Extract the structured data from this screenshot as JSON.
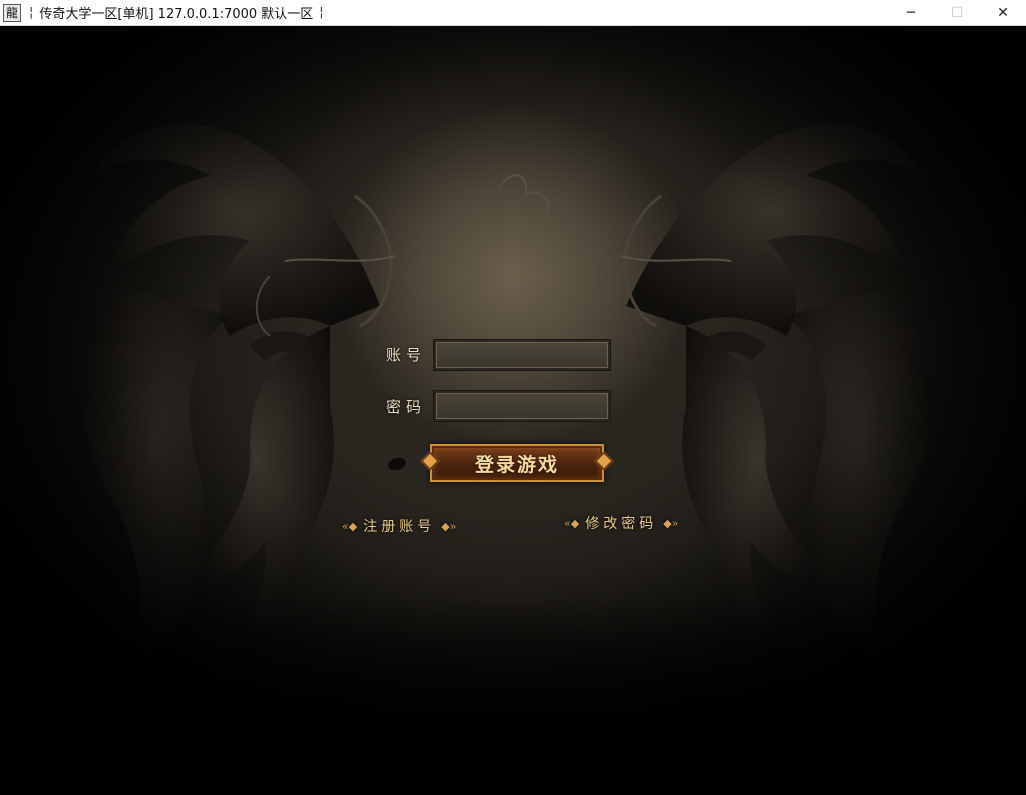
{
  "window": {
    "icon_glyph": "龍",
    "separator": "¦",
    "title": "传奇大学一区[单机] 127.0.0.1:7000  默认一区",
    "minimize": "─",
    "maximize": "☐",
    "close": "✕"
  },
  "login": {
    "account_label": "账号",
    "account_value": "",
    "password_label": "密码",
    "password_value": "",
    "login_button": "登录游戏",
    "register_link": "注册账号",
    "change_password_link": "修改密码",
    "link_arrow_left": "«◆",
    "link_arrow_right": "◆»"
  },
  "colors": {
    "label_text": "#e9dcc0",
    "button_text": "#f6dc9a",
    "link_text": "#e9c98c",
    "button_border": "#c9903e"
  },
  "icons": [
    "app-icon",
    "minimize-icon",
    "maximize-icon",
    "close-icon",
    "dragon-left-art",
    "dragon-right-art"
  ]
}
